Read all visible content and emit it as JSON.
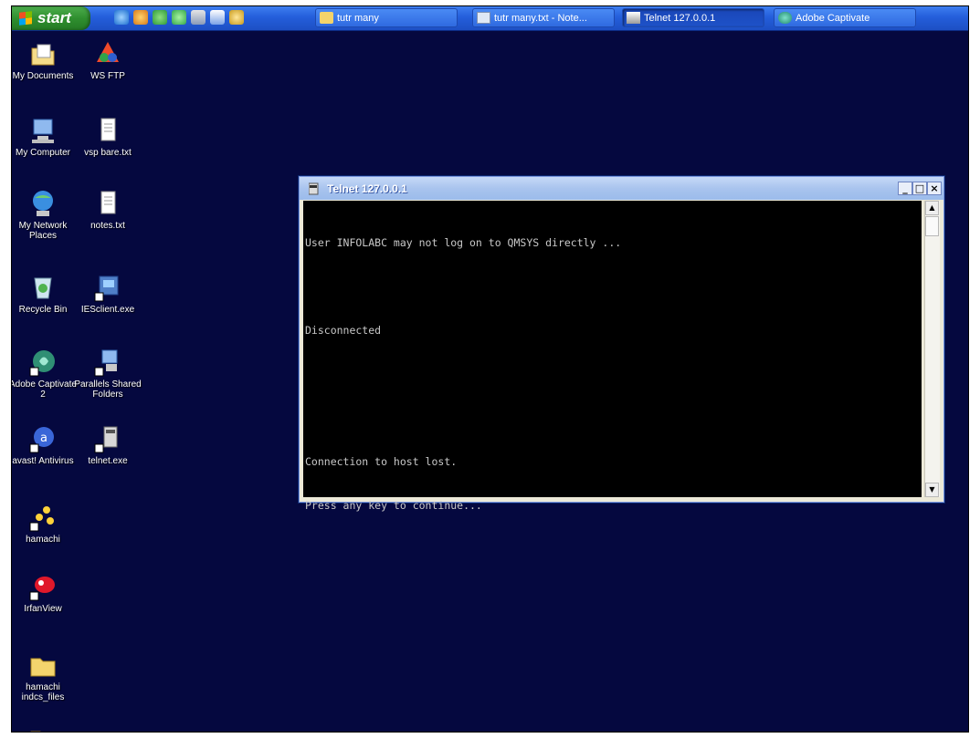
{
  "taskbar": {
    "start_label": "start",
    "tasks": [
      {
        "label": "tutr many",
        "icon": "folder-icon"
      },
      {
        "label": "tutr many.txt - Note...",
        "icon": "notepad-icon"
      },
      {
        "label": "Telnet 127.0.0.1",
        "icon": "telnet-icon",
        "active": true
      },
      {
        "label": "Adobe Captivate",
        "icon": "captivate-icon"
      }
    ]
  },
  "desktop": {
    "icons": [
      {
        "label": "My Documents",
        "icon": "my-documents-icon"
      },
      {
        "label": "WS FTP",
        "icon": "ws-ftp-icon"
      },
      {
        "label": "My Computer",
        "icon": "my-computer-icon"
      },
      {
        "label": "vsp bare.txt",
        "icon": "text-file-icon"
      },
      {
        "label": "My Network Places",
        "icon": "network-places-icon"
      },
      {
        "label": "notes.txt",
        "icon": "text-file-icon"
      },
      {
        "label": "Recycle Bin",
        "icon": "recycle-bin-icon"
      },
      {
        "label": "IESclient.exe",
        "icon": "exe-icon"
      },
      {
        "label": "Adobe Captivate 2",
        "icon": "captivate-icon"
      },
      {
        "label": "Parallels Shared Folders",
        "icon": "shared-folders-icon"
      },
      {
        "label": "avast! Antivirus",
        "icon": "avast-icon"
      },
      {
        "label": "telnet.exe",
        "icon": "telnet-exe-icon"
      },
      {
        "label": "hamachi",
        "icon": "hamachi-icon"
      },
      {
        "label": "IrfanView",
        "icon": "irfanview-icon"
      },
      {
        "label": "hamachi indcs_files",
        "icon": "folder-icon"
      }
    ]
  },
  "telnet": {
    "title": "Telnet 127.0.0.1",
    "lines": [
      "User INFOLABC may not log on to QMSYS directly ...",
      "Disconnected",
      "Connection to host lost.",
      "Press any key to continue..."
    ]
  },
  "colors": {
    "desktop_background": "#05083f",
    "taskbar_blue": "#245edb",
    "start_green": "#2f8f2f",
    "console_background": "#000000",
    "console_text": "#c8c8c8"
  }
}
